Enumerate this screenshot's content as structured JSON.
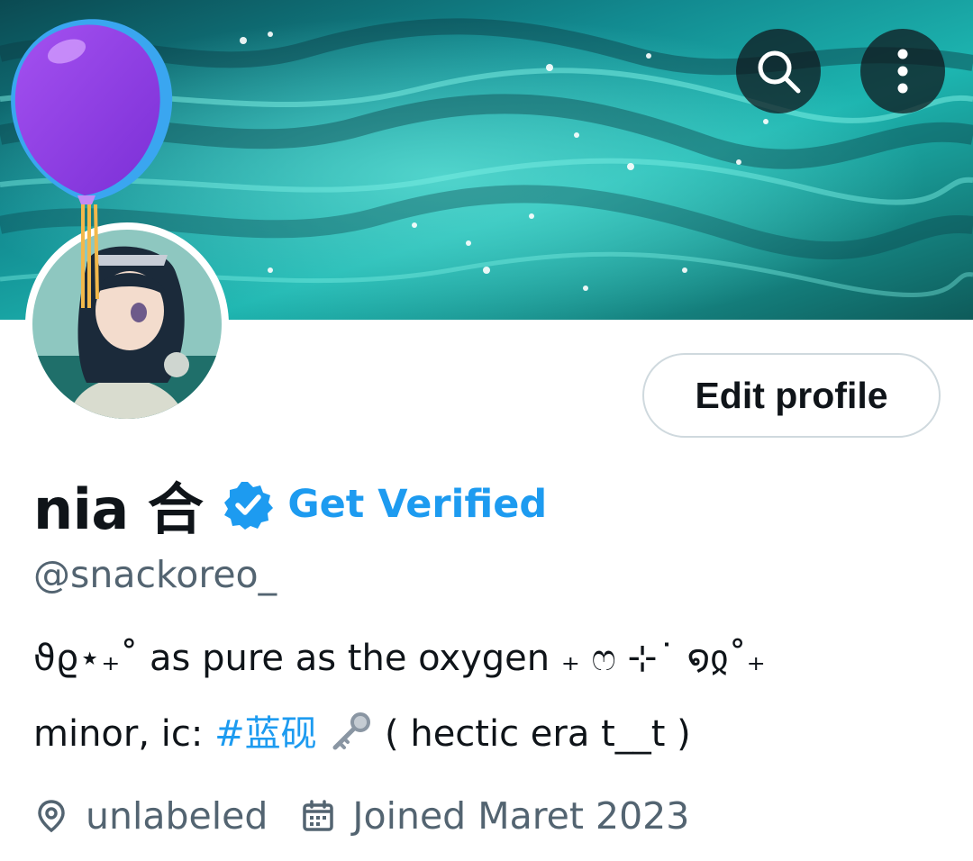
{
  "header": {
    "search_icon": "search-icon",
    "more_icon": "more-vertical-icon"
  },
  "profile": {
    "display_name": "nia 合",
    "verified_label": "Get Verified",
    "handle": "@snackoreo_",
    "edit_button_label": "Edit profile",
    "bio": {
      "line1": "ϑϱ⋆₊˚ as pure as the oxygen ₊ ෆ ⊹˙ ໑ჲ˚₊",
      "line2_prefix": "minor, ic: ",
      "hashtag": "#蓝砚",
      "line2_suffix": " ( hectic era t__t )"
    },
    "location": "unlabeled",
    "joined": "Joined Maret 2023"
  },
  "colors": {
    "accent": "#1d9bf0",
    "text_primary": "#0f1419",
    "text_secondary": "#536471",
    "border": "#cfd9de"
  }
}
